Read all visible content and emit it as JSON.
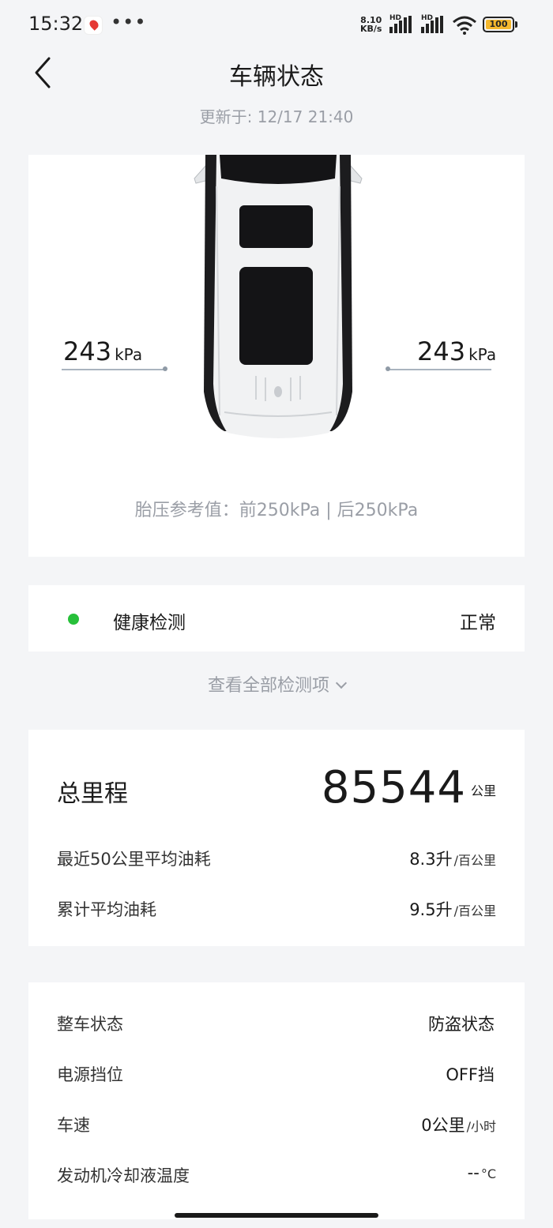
{
  "status_bar": {
    "time": "15:32",
    "more": "•••",
    "net_speed_value": "8.10",
    "net_speed_unit": "KB/s",
    "sim1_tag": "HD",
    "sim2_tag": "HD",
    "battery": "100",
    "battery_color": "#f5b82e"
  },
  "header": {
    "title": "车辆状态",
    "updated": "更新于: 12/17 21:40",
    "back_icon": "chevron-left-icon"
  },
  "tire": {
    "left_value": "243",
    "left_unit": "kPa",
    "right_value": "243",
    "right_unit": "kPa",
    "reference": "胎压参考值：前250kPa | 后250kPa"
  },
  "health": {
    "label": "健康检测",
    "status": "正常",
    "status_color": "#27c03a",
    "view_all": "查看全部检测项"
  },
  "mileage": {
    "odo_label": "总里程",
    "odo_value": "85544",
    "odo_unit": "公里",
    "rows": [
      {
        "label": "最近50公里平均油耗",
        "value": "8.3升",
        "unit": "/百公里"
      },
      {
        "label": "累计平均油耗",
        "value": "9.5升",
        "unit": "/百公里"
      }
    ]
  },
  "vehicle_status": {
    "rows": [
      {
        "label": "整车状态",
        "value": "防盗状态",
        "unit": ""
      },
      {
        "label": "电源挡位",
        "value": "OFF挡",
        "unit": ""
      },
      {
        "label": "车速",
        "value": "0公里",
        "unit": "/小时"
      },
      {
        "label": "发动机冷却液温度",
        "value": "--",
        "unit": "°C"
      }
    ]
  }
}
